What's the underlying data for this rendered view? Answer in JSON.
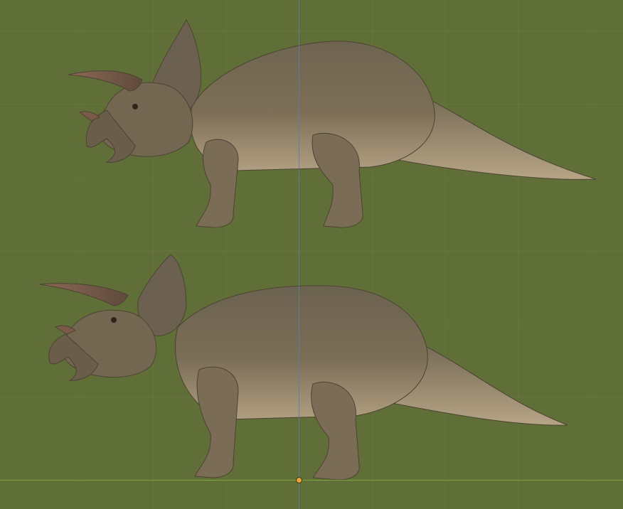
{
  "viewport": {
    "background": "#606f37",
    "grid_color": "#6b7a42",
    "z_axis_color": "#5b7fa6",
    "y_axis_color": "#7ea63a",
    "origin_color": "#f0a030"
  },
  "models": [
    {
      "id": "triceratops-upper",
      "icon": "triceratops-model"
    },
    {
      "id": "triceratops-lower",
      "icon": "triceratops-model"
    }
  ],
  "skin": {
    "back": "#6f6450",
    "belly": "#a8967a",
    "horn": "#7a5a48",
    "dark": "#4c4334"
  }
}
